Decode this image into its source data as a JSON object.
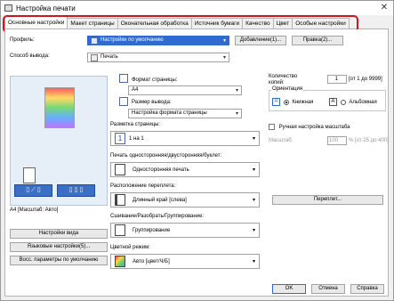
{
  "window": {
    "title": "Настройка печати",
    "close": "✕"
  },
  "tabs": [
    {
      "label": "Основные настройки"
    },
    {
      "label": "Макет страницы"
    },
    {
      "label": "Оконательная обработка"
    },
    {
      "label": "Источник бумаги"
    },
    {
      "label": "Качество"
    },
    {
      "label": "Цвет"
    },
    {
      "label": "Особые настройки"
    }
  ],
  "profile": {
    "label": "Профиль:",
    "value": "Настройки по умолчанию",
    "add_button": "Добавление(1)...",
    "edit_button": "Правка(2)..."
  },
  "output": {
    "label": "Способ вывода:",
    "value": "Печать"
  },
  "preview": {
    "caption": "A4 [Масштаб: Авто]"
  },
  "page_size": {
    "label": "Формат страницы:",
    "value": "A4"
  },
  "output_size": {
    "label": "Размер вывода:",
    "value": "Настройка формата страницы"
  },
  "layout": {
    "label": "Разметка страницы:",
    "value": "1 на 1",
    "icon_digit": "1"
  },
  "duplex": {
    "label": "Печать односторонняя/двусторонняя/буклет:",
    "value": "Односторонняя печать"
  },
  "binding": {
    "label": "Расположение переплета:",
    "value": "Длинный край [слева]",
    "gutter_button": "Переплет..."
  },
  "finishing": {
    "label": "Сшивание/Разобрать/Группирование:",
    "value": "Группирование"
  },
  "color": {
    "label": "Цветной режим:",
    "value": "Авто [цвет/Ч/Б]"
  },
  "copies": {
    "label": "Количество копий:",
    "value": "1",
    "range": "[от 1 до 9999]"
  },
  "orientation": {
    "label": "Ориентация",
    "portrait": "Книжная",
    "landscape": "Альбомная",
    "icon_letter": "A"
  },
  "scaling": {
    "checkbox": "Ручная настройка масштаба",
    "label": "Масштаб:",
    "value": "100",
    "range": "% [от 25 до 400]"
  },
  "left_buttons": {
    "view": "Настройки вида",
    "language": "Языковые настройки(5)...",
    "restore": "Восс. параметры по умолчанию"
  },
  "bottom": {
    "ok": "OK",
    "cancel": "Отмена",
    "help": "Справка"
  },
  "colors": {
    "highlight": "#d0151e",
    "accent": "#2f6ad1"
  }
}
